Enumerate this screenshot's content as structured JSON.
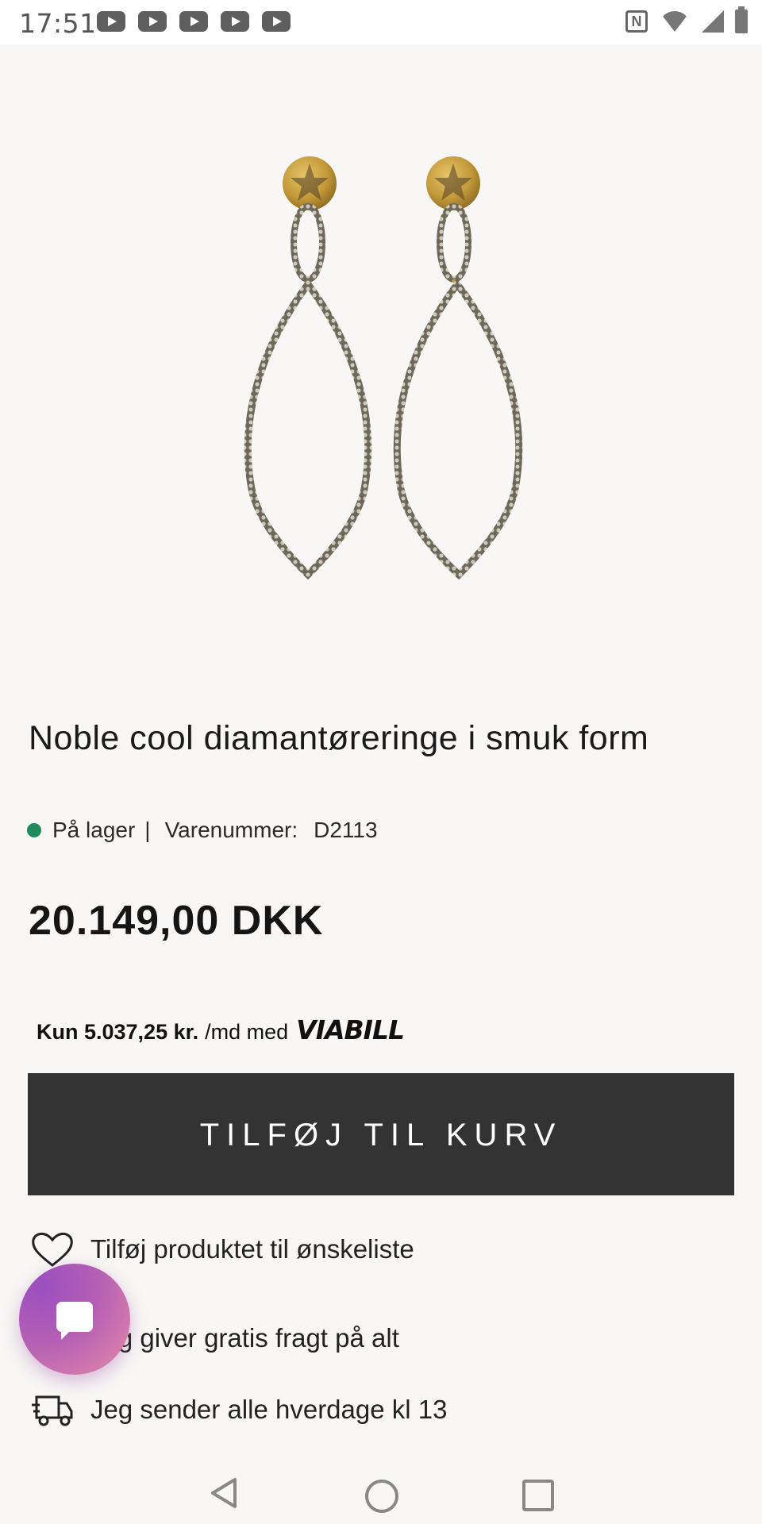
{
  "status_bar": {
    "time": "17:51",
    "notification_icons": [
      "youtube-icon",
      "youtube-icon",
      "youtube-icon",
      "youtube-icon",
      "youtube-icon"
    ],
    "system_icons": [
      "nfc-icon",
      "wifi-icon",
      "signal-icon",
      "battery-icon"
    ]
  },
  "product": {
    "image_alt": "earrings-image",
    "title": "Noble cool diamantøreringe i smuk form",
    "stock_status": "På lager",
    "stock_separator": "|",
    "sku_label": "Varenummer:",
    "sku_value": "D2113",
    "price": "20.149,00  DKK",
    "stock_color": "#1f8a5b"
  },
  "viabill": {
    "amount": "Kun 5.037,25 kr.",
    "suffix": "/md med",
    "logo_text": "VIABILL"
  },
  "actions": {
    "add_to_cart_label": "TILFØJ TIL KURV",
    "button_color": "#333333"
  },
  "features": [
    {
      "icon": "heart-icon",
      "label": "Tilføj produktet til ønskeliste"
    },
    {
      "icon": "free-shipping-icon",
      "label": "Jeg giver gratis fragt på alt"
    },
    {
      "icon": "delivery-truck-icon",
      "label": "Jeg sender alle hverdage kl 13"
    }
  ],
  "chat": {
    "icon": "chat-bubble-icon"
  },
  "nav_bar": {
    "icons": [
      "back-icon",
      "home-icon",
      "recents-icon"
    ]
  }
}
